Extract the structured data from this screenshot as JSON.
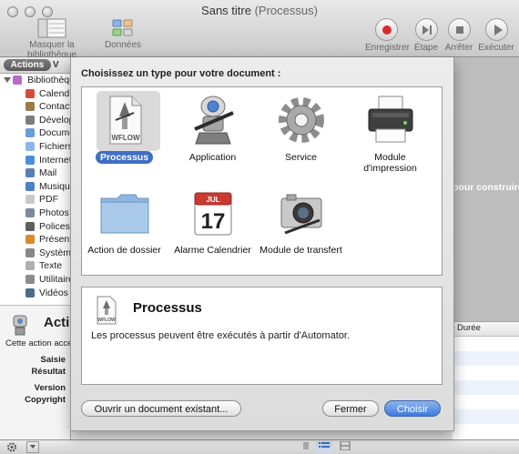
{
  "window": {
    "title": "Sans titre",
    "title_suffix": "(Processus)"
  },
  "toolbar": {
    "hide_library": "Masquer la bibliothèque",
    "data": "Données",
    "record": "Enregistrer",
    "step": "Étape",
    "stop": "Arrêter",
    "run": "Exécuter"
  },
  "left": {
    "segments": {
      "actions": "Actions",
      "variables": "V"
    },
    "library": [
      {
        "label": "Bibliothèque",
        "root": true,
        "color": "#b96ac9"
      },
      {
        "label": "Calendrier",
        "color": "#d94a3a"
      },
      {
        "label": "Contacts",
        "color": "#9b7a4c"
      },
      {
        "label": "Développeur",
        "color": "#7d7d7d"
      },
      {
        "label": "Documents",
        "color": "#6a9dd8"
      },
      {
        "label": "Fichiers",
        "color": "#8fb5e6"
      },
      {
        "label": "Internet",
        "color": "#4a90d9"
      },
      {
        "label": "Mail",
        "color": "#5a7fb5"
      },
      {
        "label": "Musique",
        "color": "#4c80c9"
      },
      {
        "label": "PDF",
        "color": "#c9c9c9"
      },
      {
        "label": "Photos",
        "color": "#7a8b99"
      },
      {
        "label": "Polices",
        "color": "#5f5f5f"
      },
      {
        "label": "Présentations",
        "color": "#d98b2b"
      },
      {
        "label": "Système",
        "color": "#888888"
      },
      {
        "label": "Texte",
        "color": "#b0b0b0"
      },
      {
        "label": "Utilitaires",
        "color": "#8c8c8c"
      },
      {
        "label": "Vidéos",
        "color": "#4d6a8f"
      }
    ],
    "description": {
      "title": "Acti",
      "text": "Cette action accepte",
      "labels": [
        "Saisie",
        "Résultat",
        "Version",
        "Copyright"
      ]
    }
  },
  "right": {
    "hint": "pour construire votre",
    "log_column": "Durée"
  },
  "sheet": {
    "prompt": "Choisissez un type pour votre document :",
    "types": [
      {
        "label": "Processus",
        "icon": "workflow-document-icon",
        "selected": true
      },
      {
        "label": "Application",
        "icon": "automator-robot-icon"
      },
      {
        "label": "Service",
        "icon": "gear-icon"
      },
      {
        "label": "Module d'impression",
        "icon": "printer-icon"
      },
      {
        "label": "Action de dossier",
        "icon": "folder-icon"
      },
      {
        "label": "Alarme Calendrier",
        "icon": "calendar-icon",
        "calendar_month": "JUL",
        "calendar_day": "17"
      },
      {
        "label": "Module de transfert",
        "icon": "camera-icon"
      }
    ],
    "icon_badge": "WFLOW",
    "detail": {
      "title": "Processus",
      "text": "Les processus peuvent être exécutés à partir d'Automator."
    },
    "buttons": {
      "open_existing": "Ouvrir un document existant...",
      "close": "Fermer",
      "choose": "Choisir"
    }
  },
  "accent": "#3e6fc4"
}
